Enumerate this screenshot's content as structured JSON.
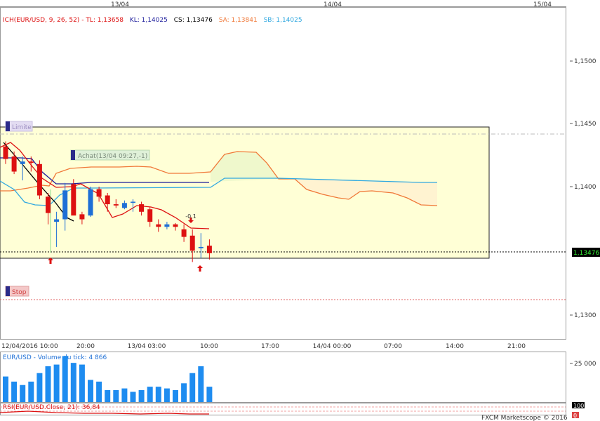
{
  "top_dates": [
    "13/04",
    "14/04",
    "15/04"
  ],
  "header": {
    "name": "ICH(EUR/USD, 9, 26, 52)",
    "tl": "TL: 1,13658",
    "kl": "KL: 1,14025",
    "cs": "CS: 1,13476",
    "sa": "SA: 1,13841",
    "sb": "SB: 1,14025"
  },
  "labels": {
    "limit": "Limite",
    "stop": "Stop",
    "order": "Achat(13/04 09:27,-1)",
    "marker": "-0,1",
    "price_tag": "1,13476"
  },
  "y_ticks": [
    "1,1500",
    "1,1450",
    "1,1400",
    "1,1300"
  ],
  "time_labels": [
    "12/04/2016 10:00",
    "20:00",
    "13/04 03:00",
    "10:00",
    "17:00",
    "14/04 00:00",
    "07:00",
    "14:00",
    "21:00"
  ],
  "volume_header": "EUR/USD - Volume du tick: 4 866",
  "volume_tick": "25 000",
  "rsi_header": "RSI(EUR/USD.Close, 21): 36,84",
  "rsi_ticks": [
    "100",
    "0"
  ],
  "footer": "FXCM Marketscope © 2016",
  "colors": {
    "up": "#1e6fd6",
    "down": "#dd1111",
    "tenkan": "#dd1111",
    "kijun": "#1a1a9a",
    "senkou_a": "#f07838",
    "senkou_b": "#30a8e0",
    "chikou": "#000000",
    "box": "#ffffd6",
    "volume": "#1e8cf0"
  },
  "chart_data": {
    "type": "candlestick",
    "ylim": [
      1.128,
      1.154
    ],
    "current_price": 1.13476,
    "limit_price": 1.144,
    "stop_price": 1.132,
    "candles": [
      {
        "o": 1.1432,
        "h": 1.1436,
        "l": 1.1418,
        "c": 1.1422
      },
      {
        "o": 1.1424,
        "h": 1.1428,
        "l": 1.141,
        "c": 1.1412
      },
      {
        "o": 1.1418,
        "h": 1.1424,
        "l": 1.1405,
        "c": 1.142
      },
      {
        "o": 1.142,
        "h": 1.1424,
        "l": 1.1412,
        "c": 1.1419
      },
      {
        "o": 1.1418,
        "h": 1.1421,
        "l": 1.139,
        "c": 1.1393
      },
      {
        "o": 1.1392,
        "h": 1.1395,
        "l": 1.137,
        "c": 1.1379
      },
      {
        "o": 1.1372,
        "h": 1.138,
        "l": 1.1352,
        "c": 1.1374
      },
      {
        "o": 1.1374,
        "h": 1.1403,
        "l": 1.1365,
        "c": 1.1397
      },
      {
        "o": 1.1402,
        "h": 1.1406,
        "l": 1.138,
        "c": 1.1377
      },
      {
        "o": 1.1378,
        "h": 1.138,
        "l": 1.137,
        "c": 1.1374
      },
      {
        "o": 1.1377,
        "h": 1.14,
        "l": 1.1376,
        "c": 1.1398
      },
      {
        "o": 1.1398,
        "h": 1.14,
        "l": 1.1388,
        "c": 1.1392
      },
      {
        "o": 1.1393,
        "h": 1.1395,
        "l": 1.138,
        "c": 1.1386
      },
      {
        "o": 1.1386,
        "h": 1.139,
        "l": 1.1383,
        "c": 1.1385
      },
      {
        "o": 1.1383,
        "h": 1.1389,
        "l": 1.1382,
        "c": 1.1387
      },
      {
        "o": 1.1388,
        "h": 1.139,
        "l": 1.138,
        "c": 1.1388
      },
      {
        "o": 1.1386,
        "h": 1.1388,
        "l": 1.1377,
        "c": 1.138
      },
      {
        "o": 1.1382,
        "h": 1.1384,
        "l": 1.1368,
        "c": 1.1372
      },
      {
        "o": 1.137,
        "h": 1.1374,
        "l": 1.1364,
        "c": 1.1368
      },
      {
        "o": 1.1368,
        "h": 1.1372,
        "l": 1.1366,
        "c": 1.137
      },
      {
        "o": 1.137,
        "h": 1.1371,
        "l": 1.1365,
        "c": 1.1368
      },
      {
        "o": 1.1366,
        "h": 1.137,
        "l": 1.1356,
        "c": 1.136
      },
      {
        "o": 1.1361,
        "h": 1.1366,
        "l": 1.134,
        "c": 1.1349
      },
      {
        "o": 1.1351,
        "h": 1.1363,
        "l": 1.1343,
        "c": 1.1352
      },
      {
        "o": 1.1353,
        "h": 1.1358,
        "l": 1.1342,
        "c": 1.1347
      }
    ],
    "volume": [
      15000,
      12000,
      10000,
      12000,
      17000,
      21000,
      22000,
      27000,
      23000,
      22000,
      13000,
      12000,
      7000,
      7000,
      8000,
      6000,
      7000,
      9000,
      9000,
      8000,
      7000,
      11000,
      17000,
      21000,
      9000
    ]
  }
}
